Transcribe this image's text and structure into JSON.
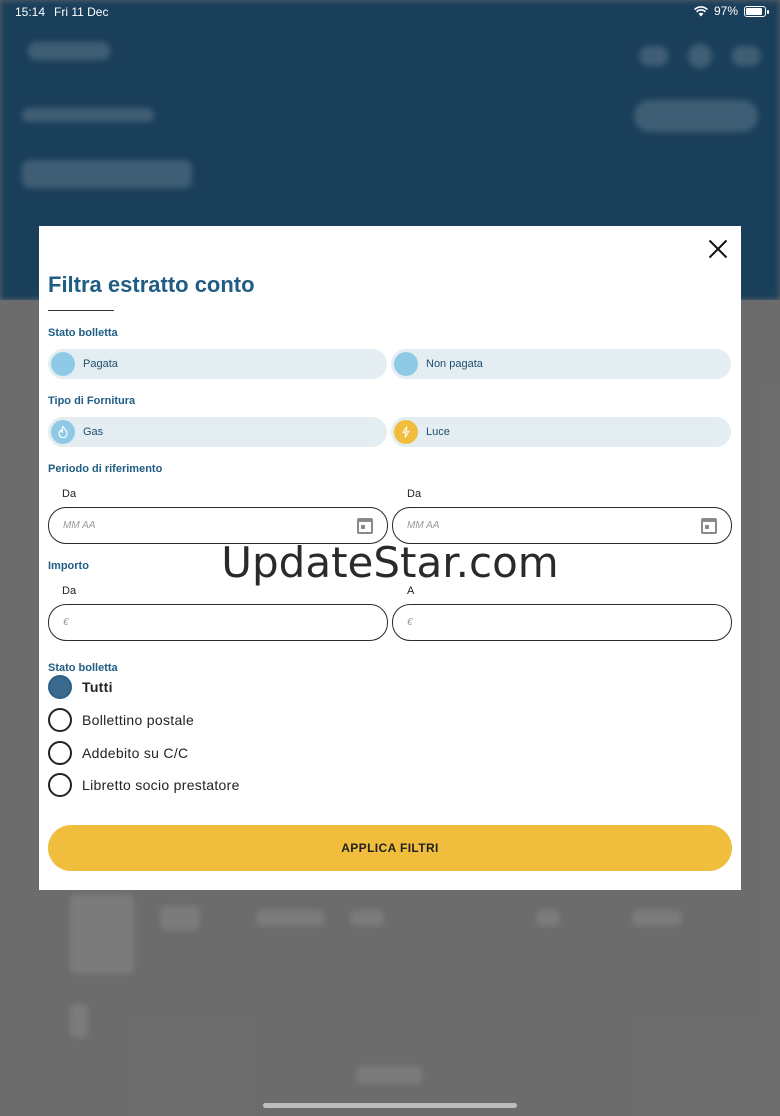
{
  "status_bar": {
    "time": "15:14",
    "date": "Fri 11 Dec",
    "battery": "97%",
    "battery_level": 0.97
  },
  "modal": {
    "title": "Filtra estratto conto",
    "stato_bolletta": {
      "label": "Stato bolletta",
      "options": [
        {
          "label": "Pagata"
        },
        {
          "label": "Non pagata"
        }
      ]
    },
    "tipo_fornitura": {
      "label": "Tipo di Fornitura",
      "options": [
        {
          "label": "Gas",
          "icon": "flame-icon",
          "color": "#8ecae6"
        },
        {
          "label": "Luce",
          "icon": "bolt-icon",
          "color": "#f1bd3c"
        }
      ]
    },
    "periodo": {
      "label": "Periodo di riferimento",
      "from_caption": "Da",
      "to_caption": "Da",
      "from_placeholder": "MM AA",
      "to_placeholder": "MM AA"
    },
    "importo": {
      "label": "Importo",
      "from_caption": "Da",
      "to_caption": "A",
      "from_placeholder": "€",
      "to_placeholder": "€"
    },
    "metodo_pagamento": {
      "label": "Stato bolletta",
      "options": [
        {
          "label": "Tutti",
          "checked": true
        },
        {
          "label": "Bollettino postale",
          "checked": false
        },
        {
          "label": "Addebito su C/C",
          "checked": false
        },
        {
          "label": "Libretto socio prestatore",
          "checked": false
        }
      ]
    },
    "apply_label": "APPLICA FILTRI"
  },
  "watermark": "UpdateStar.com",
  "colors": {
    "primary": "#1f5d84",
    "accent": "#f1bd3c",
    "pill_bg": "#e3edf2",
    "header_bg": "#1d4563"
  }
}
